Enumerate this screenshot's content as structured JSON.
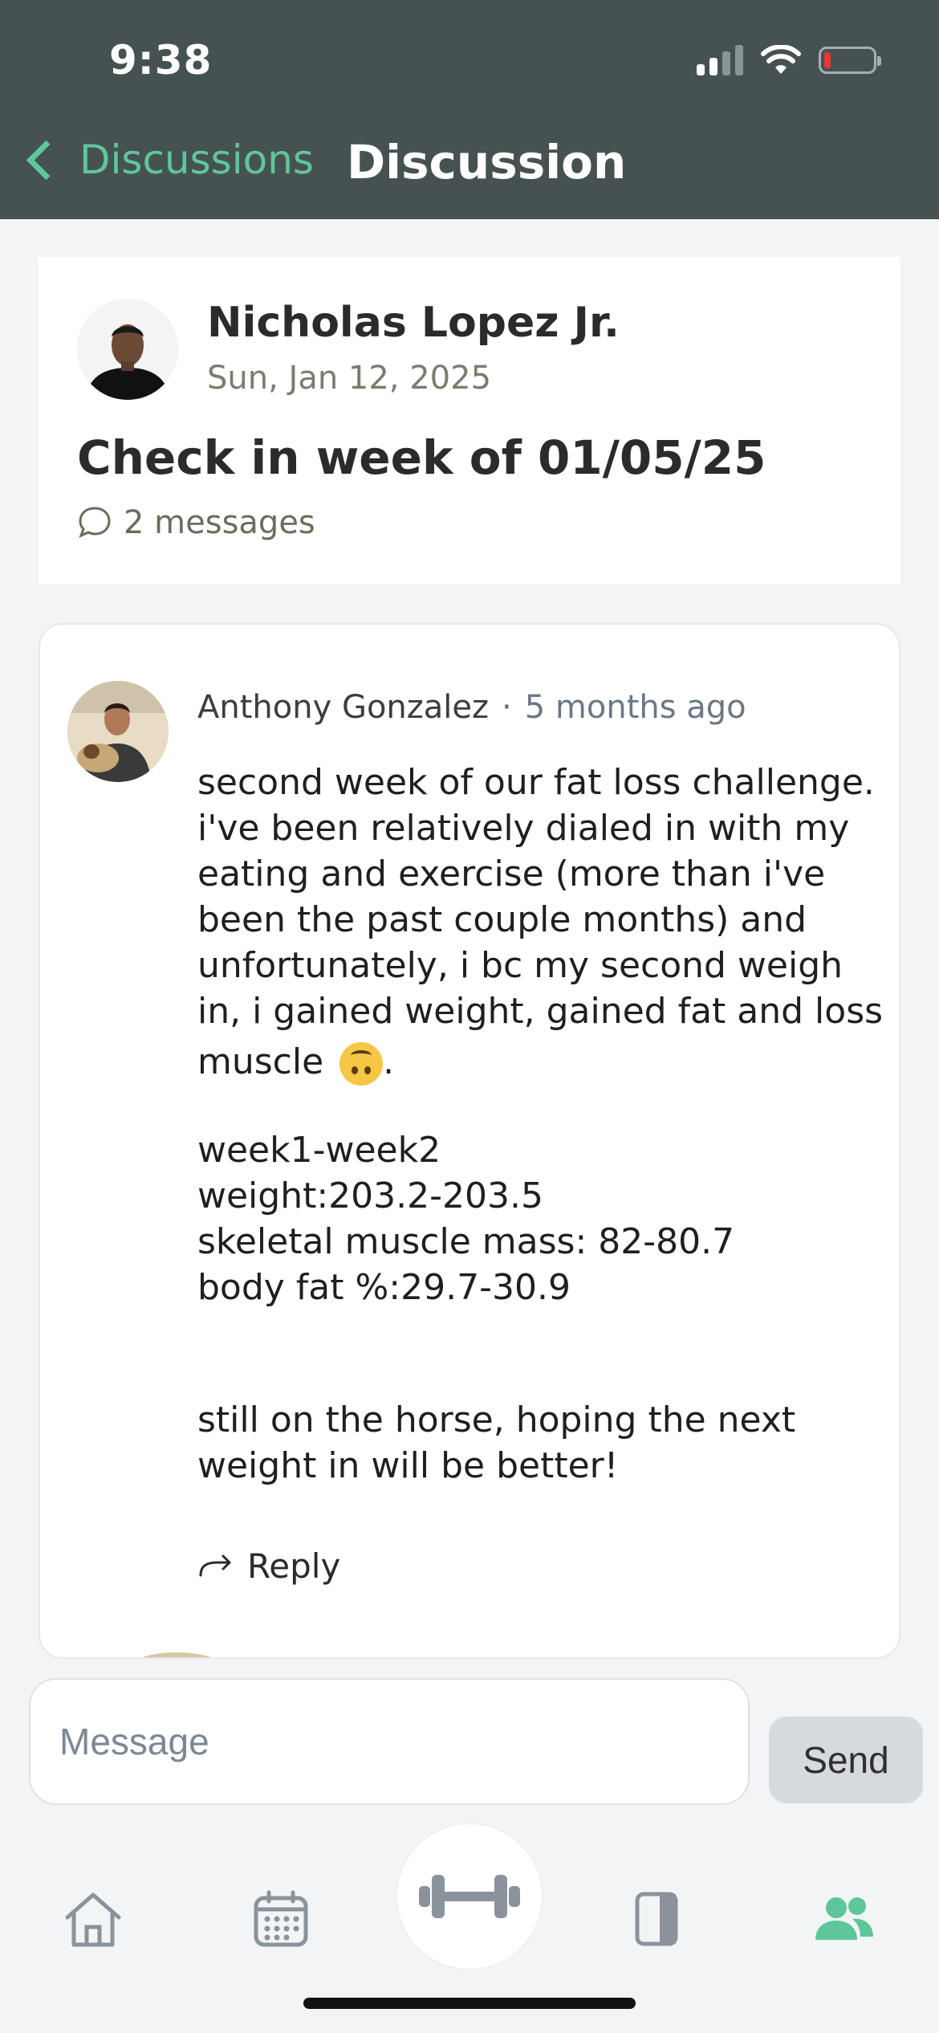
{
  "status_bar": {
    "time": "9:38"
  },
  "nav": {
    "back_label": "Discussions",
    "title": "Discussion"
  },
  "topic": {
    "author": "Nicholas Lopez Jr.",
    "date": "Sun, Jan 12, 2025",
    "title": "Check in week of 01/05/25",
    "message_count": "2 messages"
  },
  "comment": {
    "author": "Anthony Gonzalez",
    "separator": "·",
    "time_ago": "5 months ago",
    "body_lines": [
      "second week of our fat loss challenge.",
      "i've been relatively dialed in with my",
      "eating and exercise (more than i've",
      "been the past couple months) and",
      "unfortunately, i bc my second weigh",
      "in, i gained weight, gained fat and loss",
      "muscle",
      ".",
      "week1-week2",
      "weight:203.2-203.5",
      "skeletal muscle mass: 82-80.7",
      "body fat %:29.7-30.9",
      "still on the horse, hoping the next",
      "weight in will be better!"
    ],
    "reply_label": "Reply"
  },
  "composer": {
    "placeholder": "Message",
    "send_label": "Send"
  },
  "tabbar": {
    "items": [
      "home-icon",
      "calendar-icon",
      "dumbbell-icon",
      "journal-icon",
      "community-icon"
    ],
    "active_color": "#5ec79a",
    "inactive_color": "#8a939c"
  },
  "colors": {
    "header_bg": "#465152",
    "accent": "#5ec79a",
    "page_bg": "#f2f4f6"
  }
}
